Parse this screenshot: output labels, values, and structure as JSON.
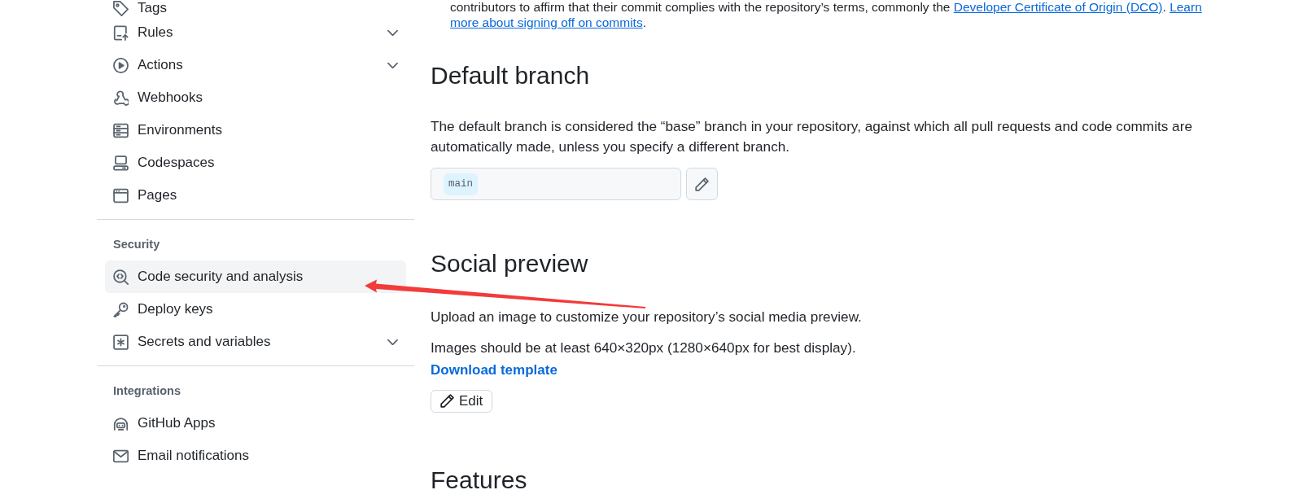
{
  "sidebar": {
    "sections": [
      {
        "items": [
          {
            "label": "Tags",
            "kind": "link",
            "selected": false
          },
          {
            "label": "Rules",
            "kind": "group",
            "selected": false
          },
          {
            "label": "Actions",
            "kind": "group",
            "selected": false
          },
          {
            "label": "Webhooks",
            "kind": "link",
            "selected": false
          },
          {
            "label": "Environments",
            "kind": "link",
            "selected": false
          },
          {
            "label": "Codespaces",
            "kind": "link",
            "selected": false
          },
          {
            "label": "Pages",
            "kind": "link",
            "selected": false
          }
        ]
      },
      {
        "heading": "Security",
        "items": [
          {
            "label": "Code security and analysis",
            "kind": "link",
            "selected": true
          },
          {
            "label": "Deploy keys",
            "kind": "link",
            "selected": false
          },
          {
            "label": "Secrets and variables",
            "kind": "group",
            "selected": false
          }
        ]
      },
      {
        "heading": "Integrations",
        "items": [
          {
            "label": "GitHub Apps",
            "kind": "link",
            "selected": false
          },
          {
            "label": "Email notifications",
            "kind": "link",
            "selected": false
          }
        ]
      }
    ]
  },
  "sign_off_note": {
    "lines": [
      [
        {
          "kind": "text",
          "text": "contributors to affirm that their commit complies with the repository’s terms, commonly the "
        },
        {
          "kind": "link",
          "text": "Developer Certificate of Origin (DCO)"
        },
        {
          "kind": "text",
          "text": ". "
        },
        {
          "kind": "link",
          "text": "Learn"
        }
      ],
      [
        {
          "kind": "link",
          "text": "more about signing off on commits"
        },
        {
          "kind": "text",
          "text": "."
        }
      ]
    ]
  },
  "default_branch": {
    "title": "Default branch",
    "description": "The default branch is considered the “base” branch in your repository, against which all pull requests and code commits are automatically made, unless you specify a different branch.",
    "branch": "main"
  },
  "social_preview": {
    "title": "Social preview",
    "description": "Upload an image to customize your repository’s social media preview.",
    "requirements": "Images should be at least 640×320px (1280×640px for best display).",
    "template_link": "Download template",
    "edit_button": "Edit"
  },
  "features": {
    "title": "Features"
  }
}
